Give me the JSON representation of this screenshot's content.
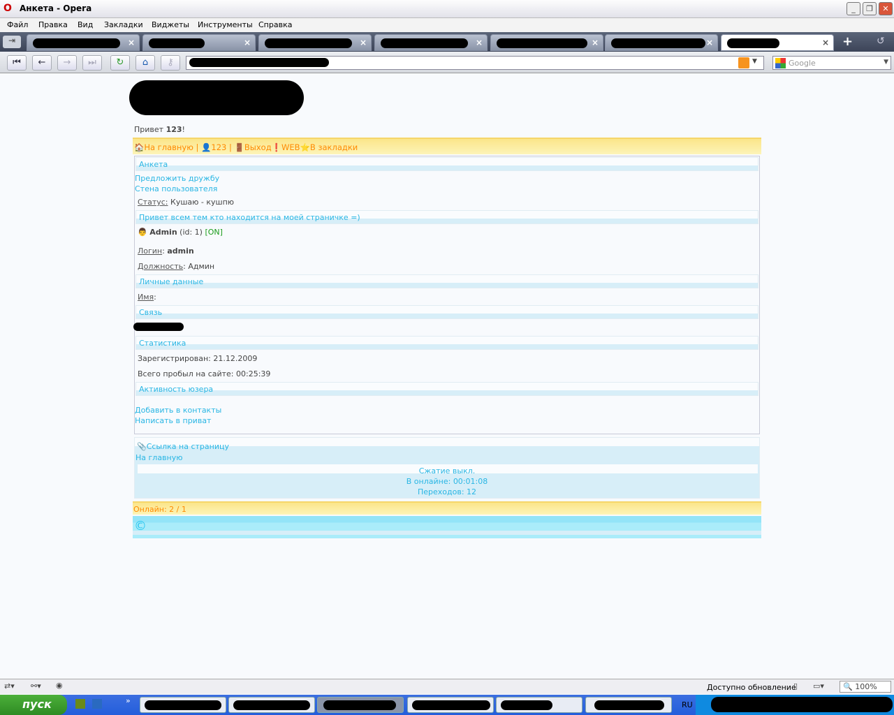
{
  "window": {
    "title": "Анкета - Opera"
  },
  "menu": [
    "Файл",
    "Правка",
    "Вид",
    "Закладки",
    "Виджеты",
    "Инструменты",
    "Справка"
  ],
  "search": {
    "placeholder": "Google"
  },
  "page": {
    "greeting_prefix": "Привет ",
    "greeting_user": "123",
    "greeting_suffix": "!",
    "nav": {
      "home": "На главную",
      "sep": " | ",
      "user": "123",
      "exit": "Выход",
      "web": "WEB",
      "bookmarks": "В закладки"
    },
    "profile_header": "Анкета",
    "offer_friendship": "Предложить дружбу",
    "user_wall": "Стена пользователя",
    "status_label": "Статус:",
    "status_value": " Кушаю - кушпю",
    "status_message": "Привет всем тем кто находится на моей страничке =)",
    "user_name": "Admin",
    "user_id": " (id: 1) ",
    "online_badge": "[ON]",
    "login_label": "Логин",
    "login_value": "admin",
    "position_label": "Должность",
    "position_value": "Админ",
    "personal_header": "Личные данные",
    "name_label": "Имя",
    "contact_header": "Связь",
    "stats_header": "Статистика",
    "registered": "Зарегистрирован: 21.12.2009",
    "time_on_site": "Всего пробыл на сайте: 00:25:39",
    "activity_header": "Активность юзера",
    "add_contacts": "Добавить в контакты",
    "write_private": "Написать в приват",
    "page_link": "Ссылка на страницу",
    "home_link": "На главную",
    "compression": "Сжатие выкл.",
    "online_time": "В онлайне: 00:01:08",
    "transitions": "Переходов: 12",
    "online_count": "Онлайн: 2 / 1"
  },
  "statusbar": {
    "update": "Доступно обновление",
    "zoom": "100%"
  },
  "taskbar": {
    "start": "пуск",
    "lang": "RU"
  },
  "colors": {
    "link": "#29b6e4",
    "orange": "#ff8a00",
    "online": "#1a9c1a"
  }
}
